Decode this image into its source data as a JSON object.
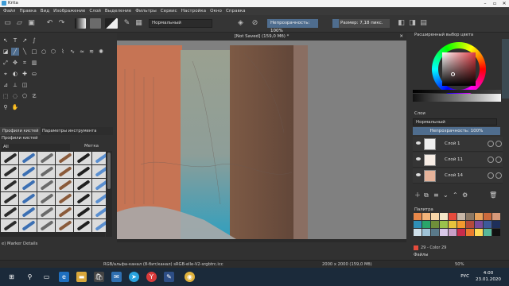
{
  "window": {
    "title": "Krita"
  },
  "menu": [
    "Файл",
    "Правка",
    "Вид",
    "Изображение",
    "Слой",
    "Выделение",
    "Фильтры",
    "Сервис",
    "Настройка",
    "Окно",
    "Справка"
  ],
  "toolbar": {
    "blend_mode": "Нормальный",
    "opacity": "Непрозрачность: 100%",
    "size": "Размер: 7,18 пикс."
  },
  "canvas": {
    "tab_title": "[Not Saved] (159,0 Мб) *",
    "icons": [
      "move-icon",
      "select-icon"
    ]
  },
  "brush_presets": {
    "tabs": [
      "Профили кистей",
      "Параметры инструмента"
    ],
    "title": "Профили кистей",
    "filter_value": "All",
    "tag_label": "Метка",
    "current_brush": "e) Marker Details"
  },
  "color_selector": {
    "title": "Расширенный выбор цвета"
  },
  "layers": {
    "title": "Слои",
    "mode": "Нормальный",
    "opacity": "Непрозрачность: 100%",
    "items": [
      {
        "name": "Слой 1"
      },
      {
        "name": "Слой 11"
      },
      {
        "name": "Слой 14"
      }
    ]
  },
  "palette": {
    "title": "Палитра",
    "current": "29 - Color 29",
    "tab": "Файлы",
    "colors": [
      "#e8884a",
      "#f2b47a",
      "#f8d6a8",
      "#f5e7c8",
      "#e64b3c",
      "#c8b7a7",
      "#8c7864",
      "#e8a25c",
      "#cc6a3c",
      "#d89a7a",
      "#2f8fb6",
      "#2aa56a",
      "#6f8f3a",
      "#9ac24c",
      "#e6c33c",
      "#f29a2e",
      "#b54a3a",
      "#7a4b9a",
      "#3c5a9a",
      "#1e2f5a",
      "#cfe0ea",
      "#9fc3d6",
      "#5a7a8a",
      "#d8c8e8",
      "#c8a0c8",
      "#c82c4c",
      "#ea7b2e",
      "#ffdb58",
      "#58b89a",
      "#111111"
    ]
  },
  "status": {
    "color_info": "RGB/альфа-канал (8-бит/канал)  sRGB-elle-V2-srgbtrc.icc",
    "dimensions": "2000 x 2000 (159,0 Мб)",
    "zoom": "50%"
  },
  "taskbar": {
    "language": "РУС",
    "time": "4:00",
    "date": "23.01.2020"
  }
}
